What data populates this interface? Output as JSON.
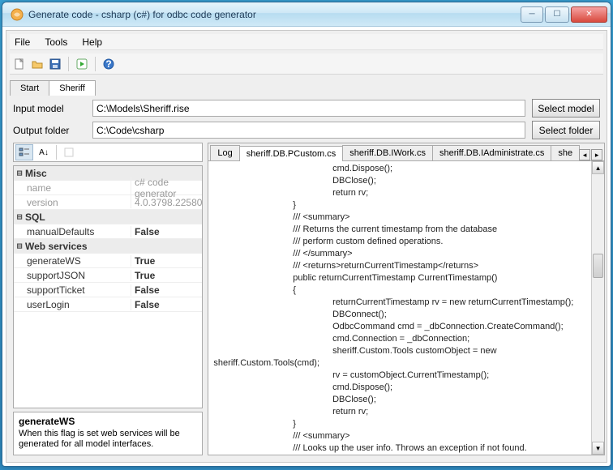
{
  "window": {
    "title": "Generate code - csharp (c#) for odbc code generator"
  },
  "menu": {
    "file": "File",
    "tools": "Tools",
    "help": "Help"
  },
  "toptabs": {
    "start": "Start",
    "active": "Sheriff"
  },
  "form": {
    "inputLabel": "Input model",
    "inputValue": "C:\\Models\\Sheriff.rise",
    "outputLabel": "Output folder",
    "outputValue": "C:\\Code\\csharp",
    "selectModel": "Select model",
    "selectFolder": "Select folder"
  },
  "propgrid": {
    "categories": [
      {
        "name": "Misc",
        "rows": [
          {
            "key": "name",
            "val": "c# code generator",
            "dim": true
          },
          {
            "key": "version",
            "val": "4.0.3798.22580",
            "dim": true
          }
        ]
      },
      {
        "name": "SQL",
        "rows": [
          {
            "key": "manualDefaults",
            "val": "False",
            "bold": true
          }
        ]
      },
      {
        "name": "Web services",
        "rows": [
          {
            "key": "generateWS",
            "val": "True",
            "bold": true
          },
          {
            "key": "supportJSON",
            "val": "True",
            "bold": true
          },
          {
            "key": "supportTicket",
            "val": "False",
            "bold": true
          },
          {
            "key": "userLogin",
            "val": "False",
            "bold": true
          }
        ]
      }
    ],
    "help": {
      "name": "generateWS",
      "desc": "When this flag is set web services will be generated for all model interfaces."
    }
  },
  "codetabs": {
    "items": [
      "Log",
      "sheriff.DB.PCustom.cs",
      "sheriff.DB.IWork.cs",
      "sheriff.DB.IAdministrate.cs",
      "she"
    ],
    "activeIndex": 1
  },
  "code": "                                                cmd.Dispose();\n                                                DBClose();\n                                                return rv;\n                                }\n                                /// <summary>\n                                /// Returns the current timestamp from the database\n                                /// perform custom defined operations.\n                                /// </summary>\n                                /// <returns>returnCurrentTimestamp</returns>\n                                public returnCurrentTimestamp CurrentTimestamp()\n                                {\n                                                returnCurrentTimestamp rv = new returnCurrentTimestamp();\n                                                DBConnect();\n                                                OdbcCommand cmd = _dbConnection.CreateCommand();\n                                                cmd.Connection = _dbConnection;\n                                                sheriff.Custom.Tools customObject = new\nsheriff.Custom.Tools(cmd);\n                                                rv = customObject.CurrentTimestamp();\n                                                cmd.Dispose();\n                                                DBClose();\n                                                return rv;\n                                }\n                                /// <summary>\n                                /// Looks up the user info. Throws an exception if not found.\n                                /// perform custom defined operations."
}
